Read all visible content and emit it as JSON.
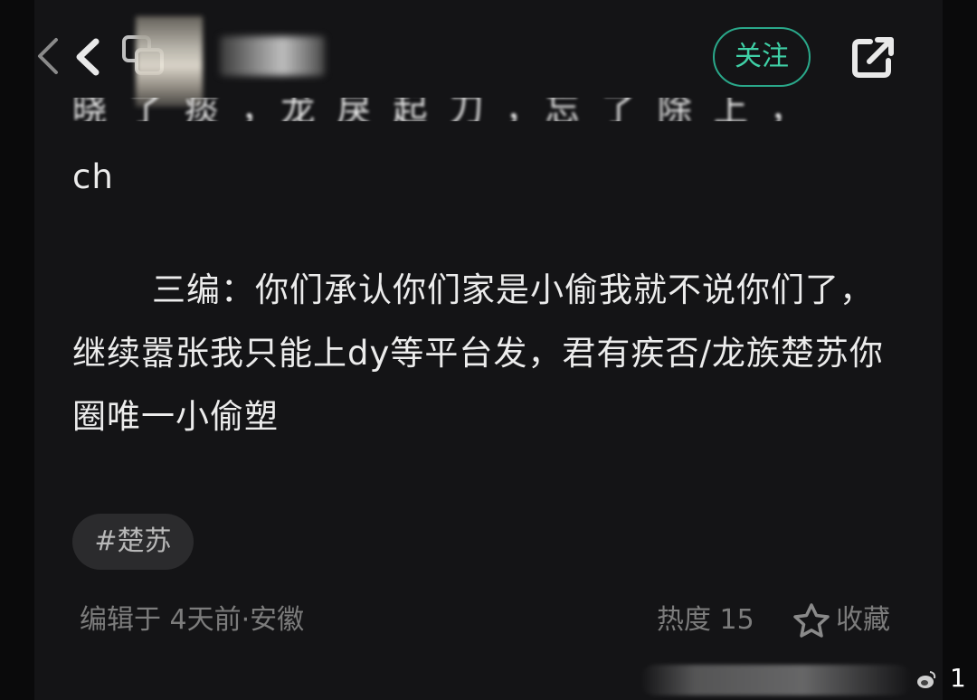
{
  "header": {
    "username": "",
    "follow_label": "关注",
    "icons": {
      "back": "chevron-left-icon",
      "window": "window-icon",
      "share": "share-icon"
    }
  },
  "post": {
    "cut_line": "晓 了 痰              ，龙 戾 起 刀 ，忘 了 除 上 ，",
    "line_ch": "ch",
    "paragraph": "三编：你们承认你们家是小偷我就不说你们了，继续嚣张我只能上dy等平台发，君有疾否/龙族楚苏你圈唯一小偷塑",
    "tag": "#楚苏"
  },
  "footer": {
    "edited": "编辑于 4天前·安徽",
    "heat": "热度 15",
    "favorite_label": "收藏"
  },
  "page_number": "1",
  "colors": {
    "background": "#141416",
    "accent": "#3fd0a6",
    "muted": "#7c7c7c"
  }
}
